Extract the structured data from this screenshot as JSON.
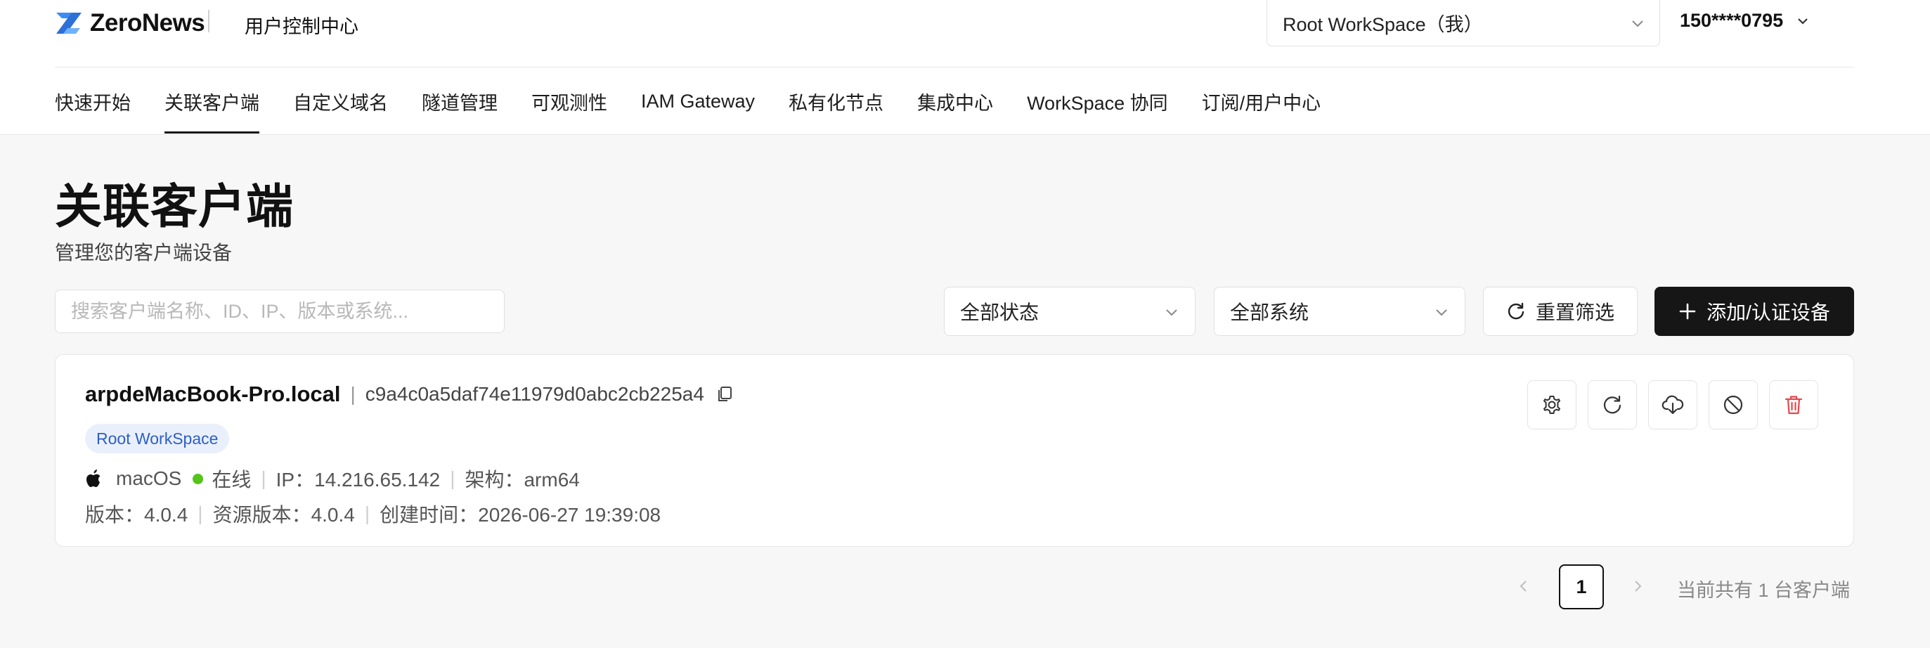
{
  "brand": {
    "name": "ZeroNews",
    "console_title": "用户控制中心",
    "accent_color": "#3b8cf5"
  },
  "topbar": {
    "workspace_select": "Root WorkSpace（我）",
    "user_phone": "150****0795"
  },
  "nav": {
    "items": [
      {
        "label": "快速开始",
        "active": false
      },
      {
        "label": "关联客户端",
        "active": true
      },
      {
        "label": "自定义域名",
        "active": false
      },
      {
        "label": "隧道管理",
        "active": false
      },
      {
        "label": "可观测性",
        "active": false
      },
      {
        "label": "IAM Gateway",
        "active": false
      },
      {
        "label": "私有化节点",
        "active": false
      },
      {
        "label": "集成中心",
        "active": false
      },
      {
        "label": "WorkSpace 协同",
        "active": false
      },
      {
        "label": "订阅/用户中心",
        "active": false
      }
    ]
  },
  "page": {
    "title": "关联客户端",
    "subtitle": "管理您的客户端设备"
  },
  "filters": {
    "search_placeholder": "搜索客户端名称、ID、IP、版本或系统...",
    "status_select": "全部状态",
    "system_select": "全部系统",
    "reset_label": "重置筛选",
    "add_label": "添加/认证设备"
  },
  "devices": [
    {
      "name": "arpdeMacBook-Pro.local",
      "id": "c9a4c0a5daf74e11979d0abc2cb225a4",
      "workspace_tag": "Root WorkSpace",
      "os": "macOS",
      "status": "在线",
      "status_color": "#52c41a",
      "ip": "IP：14.216.65.142",
      "arch": "架构：arm64",
      "version": "版本：4.0.4",
      "resource_version": "资源版本：4.0.4",
      "created": "创建时间：2026-06-27 19:39:08",
      "actions": [
        "gear-icon",
        "refresh-icon",
        "download-icon",
        "disable-icon",
        "trash-icon"
      ],
      "delete_color": "#e5484d"
    }
  ],
  "pagination": {
    "current_page": "1",
    "total_text": "当前共有 1 台客户端"
  }
}
